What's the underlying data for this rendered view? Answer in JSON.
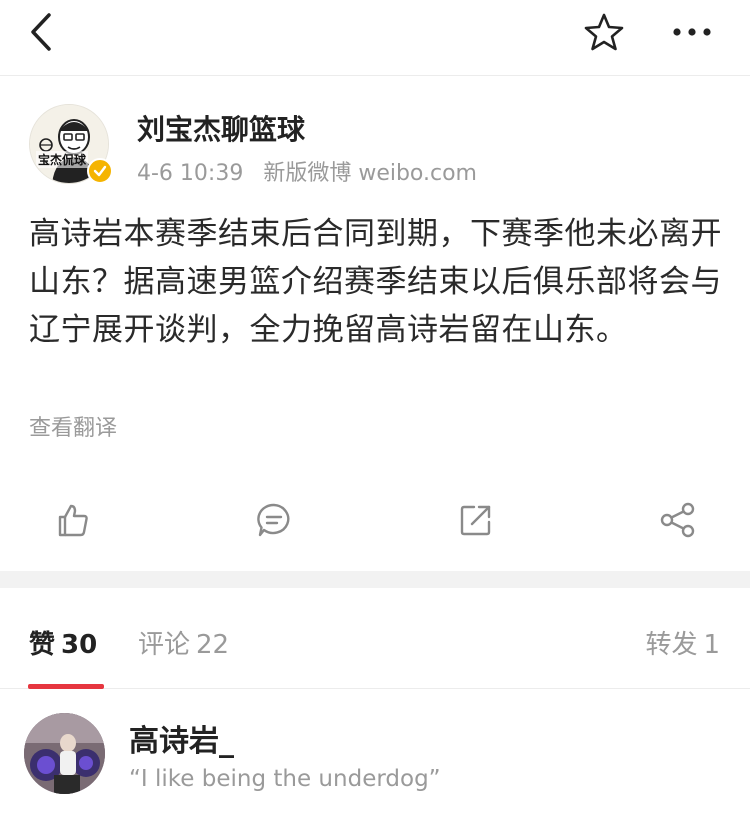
{
  "nav": {
    "back_icon": "chevron-left-icon",
    "favorite_icon": "star-outline-icon",
    "more_icon": "more-horizontal-icon"
  },
  "post": {
    "author": "刘宝杰聊篮球",
    "avatar_text": "宝杰侃球",
    "verified": true,
    "verified_color": "#f5b400",
    "time": "4-6 10:39",
    "source": "新版微博 weibo.com",
    "text": "高诗岩本赛季结束后合同到期，下赛季他未必离开山东？据高速男篮介绍赛季结束以后俱乐部将会与辽宁展开谈判，全力挽留高诗岩留在山东。",
    "translate_label": "查看翻译"
  },
  "actions": [
    {
      "name": "like",
      "icon": "thumbs-up-icon"
    },
    {
      "name": "comment",
      "icon": "comment-icon"
    },
    {
      "name": "repost",
      "icon": "repost-icon"
    },
    {
      "name": "share",
      "icon": "share-icon"
    }
  ],
  "tabs": {
    "likes_label": "赞",
    "likes_count": "30",
    "comments_label": "评论",
    "comments_count": "22",
    "reposts_label": "转发",
    "reposts_count": "1",
    "active_color": "#e6363f"
  },
  "likers": [
    {
      "name": "高诗岩_",
      "bio": "“I like being the underdog”"
    }
  ]
}
